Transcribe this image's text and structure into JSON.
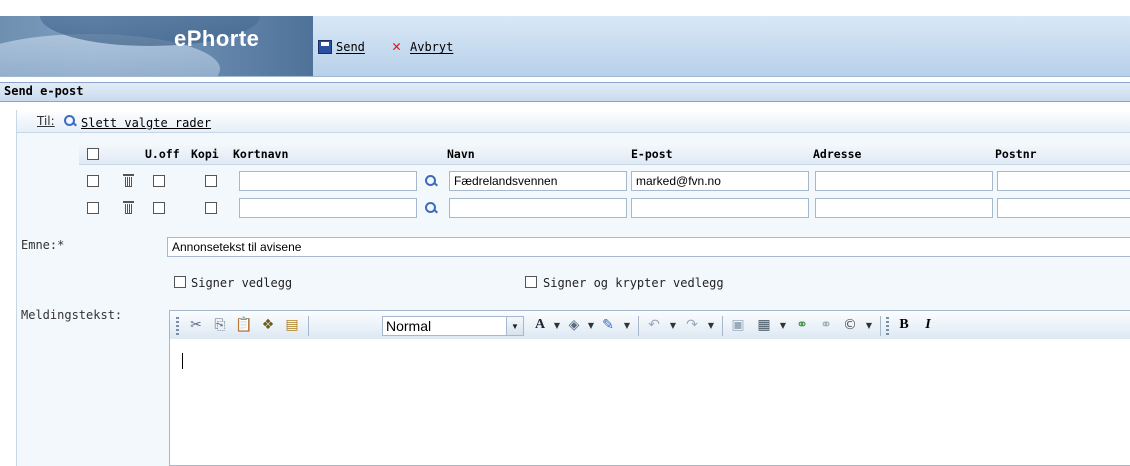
{
  "app": {
    "logo": "ePhorte"
  },
  "toolbar": {
    "send_label": "Send",
    "cancel_label": "Avbryt"
  },
  "section": {
    "title": "Send e-post"
  },
  "recipients": {
    "to_label": "Til:",
    "delete_rows_label": "Slett valgte rader",
    "columns": {
      "uoff": "U.off",
      "kopi": "Kopi",
      "kortnavn": "Kortnavn",
      "navn": "Navn",
      "epost": "E-post",
      "adresse": "Adresse",
      "postnr": "Postnr"
    },
    "rows": [
      {
        "kortnavn": "",
        "navn": "Fædrelandsvennen",
        "epost": "marked@fvn.no",
        "adresse": "",
        "postnr": ""
      },
      {
        "kortnavn": "",
        "navn": "",
        "epost": "",
        "adresse": "",
        "postnr": ""
      }
    ]
  },
  "subject": {
    "label": "Emne:*",
    "value": "Annonsetekst til avisene"
  },
  "options": {
    "sign_label": "Signer vedlegg",
    "sign_encrypt_label": "Signer og krypter vedlegg"
  },
  "message": {
    "label": "Meldingstekst:",
    "format_value": "Normal",
    "bold": "B",
    "italic": "I"
  },
  "colors": {
    "accent": "#3a6cc0",
    "header_bg": "#c9dbee"
  }
}
